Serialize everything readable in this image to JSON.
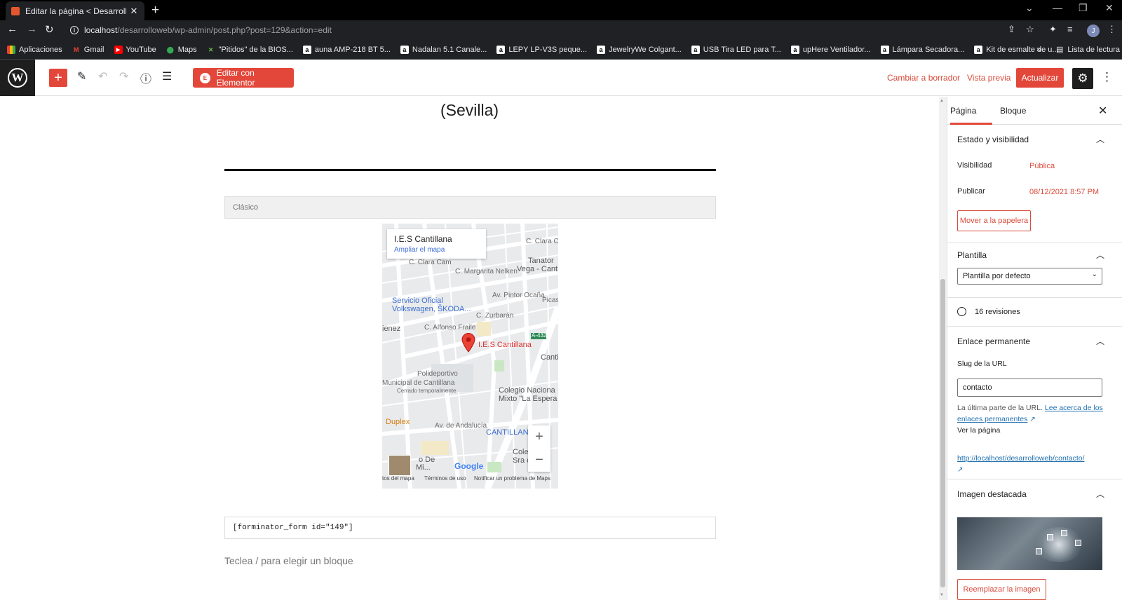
{
  "browser": {
    "tab_title": "Editar la página < Desarrollo Web",
    "url_host": "localhost",
    "url_path": "/desarrolloweb/wp-admin/post.php?post=129&action=edit",
    "bookmarks": [
      {
        "label": "Aplicaciones",
        "icon": "apps-grid-icon",
        "color": "#ea4335"
      },
      {
        "label": "Gmail",
        "icon": "gmail-icon",
        "color": "#ea4335"
      },
      {
        "label": "YouTube",
        "icon": "youtube-icon",
        "color": "#ff0000"
      },
      {
        "label": "Maps",
        "icon": "maps-pin-icon",
        "color": "#34a853"
      },
      {
        "label": "\"Pitidos\" de la BIOS...",
        "icon": "bios-icon",
        "color": "#6abf4b"
      },
      {
        "label": "auna AMP-218 BT 5...",
        "icon": "amazon-icon",
        "color": "#ffffff"
      },
      {
        "label": "Nadalan 5.1 Canale...",
        "icon": "amazon-icon",
        "color": "#ffffff"
      },
      {
        "label": "LEPY LP-V3S peque...",
        "icon": "amazon-icon",
        "color": "#ffffff"
      },
      {
        "label": "JewelryWe Colgant...",
        "icon": "amazon-icon",
        "color": "#ffffff"
      },
      {
        "label": "USB Tira LED para T...",
        "icon": "amazon-icon",
        "color": "#ffffff"
      },
      {
        "label": "upHere Ventilador...",
        "icon": "amazon-icon",
        "color": "#ffffff"
      },
      {
        "label": "Lámpara Secadora...",
        "icon": "amazon-icon",
        "color": "#ffffff"
      },
      {
        "label": "Kit de esmalte de u...",
        "icon": "amazon-icon",
        "color": "#ffffff"
      }
    ],
    "more": "»",
    "reading_list": "Lista de lectura",
    "avatar_letter": "J"
  },
  "toolbar": {
    "elementor_label": "Editar con Elementor",
    "switch_draft": "Cambiar a borrador",
    "preview": "Vista previa",
    "update": "Actualizar",
    "accent_color": "#e2473a"
  },
  "content": {
    "heading_tail": "(Sevilla)",
    "classic_label": "Clásico",
    "shortcode": "[forminator_form id=\"149\"]",
    "placeholder": "Teclea / para elegir un bloque"
  },
  "map": {
    "card_title": "I.E.S Cantillana",
    "card_link": "Ampliar el mapa",
    "pin_label": "I.E.S Cantillana",
    "labels": {
      "clara_top": "C. Clara Ca",
      "tanator": "Tanator",
      "vega": "Vega - Canti",
      "clara_cam": "C. Clara Cam",
      "margarita": "C. Margarita Nelken",
      "servicio": "Servicio Oficial",
      "volkswagen": "Volkswagen, ŠKODA...",
      "pintor": "Av. Pintor Ocaña",
      "zurbaran": "C. Zurbarán",
      "picasso": "Picasso",
      "jimenez": "ienez",
      "alfonso": "C. Alfonso Fraile",
      "a432": "A-432",
      "canti": "Canti",
      "polideportivo": "Polideportivo",
      "municipal": "Municipal de Cantillana",
      "cerrado": "Cerrado temporalmente",
      "colegio1": "Colegio Naciona",
      "colegio2": "Mixto \"La Espera",
      "duplex": "Duplex",
      "andalucia": "Av. de Andalucía",
      "cantillana_caps": "CANTILLANA",
      "poso1": "o De",
      "poso2": "Mi...",
      "colegio_sra1": "Cole",
      "colegio_sra2": "Sra c"
    },
    "zoom_in": "+",
    "zoom_out": "−",
    "google": "Google",
    "footer_data": "tos del mapa",
    "footer_terms": "Términos de uso",
    "footer_report": "Notificar un problema de Maps"
  },
  "sidebar": {
    "tabs": [
      "Página",
      "Bloque"
    ],
    "status_title": "Estado y visibilidad",
    "visibility_label": "Visibilidad",
    "visibility_value": "Pública",
    "publish_label": "Publicar",
    "publish_value": "08/12/2021 8:57 PM",
    "trash_button": "Mover a la papelera",
    "template_title": "Plantilla",
    "template_value": "Plantilla por defecto",
    "revisions": "16 revisiones",
    "permalink_title": "Enlace permanente",
    "slug_label": "Slug de la URL",
    "slug_value": "contacto",
    "help_text": "La última parte de la URL.",
    "help_link": "Lee acerca de los enlaces permanentes",
    "view_page": "Ver la página",
    "permalink_url": "http://localhost/desarrolloweb/contacto/",
    "featured_title": "Imagen destacada",
    "replace_button": "Reemplazar la imagen"
  }
}
